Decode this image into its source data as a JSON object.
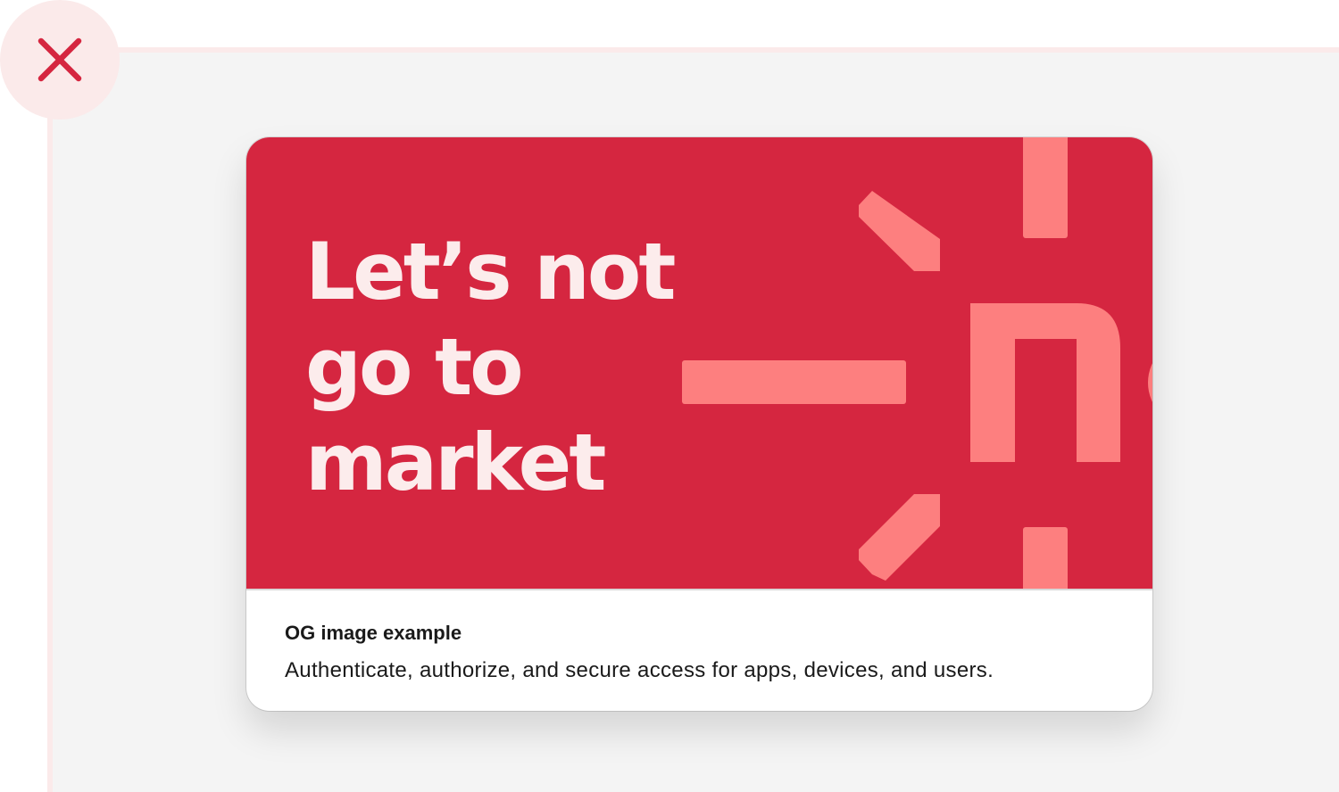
{
  "status": {
    "icon": "close-icon",
    "meaning": "incorrect-example"
  },
  "preview_card": {
    "image": {
      "headline_lines": [
        "Let’s not",
        "go to",
        "market"
      ],
      "logo_icon": "brand-logo-icon"
    },
    "title": "OG image example",
    "description": "Authenticate, authorize, and secure access for apps, devices, and users."
  },
  "colors": {
    "accent": "#d52640",
    "accent_soft": "#fd7f7f",
    "headline": "#fcecec",
    "badge_bg": "#fbeaea",
    "panel_bg": "#f4f4f4",
    "text": "#1a1a1a"
  }
}
